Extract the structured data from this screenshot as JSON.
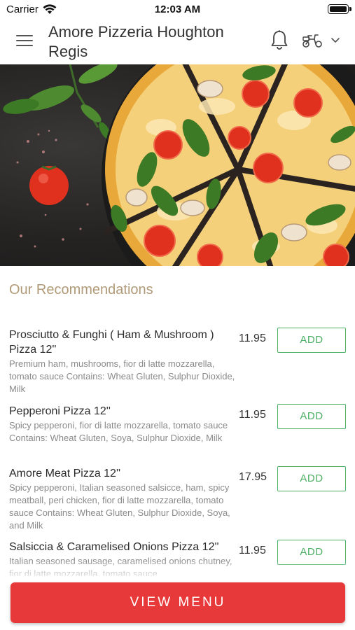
{
  "status_bar": {
    "carrier": "Carrier",
    "time": "12:03 AM"
  },
  "header": {
    "title": "Amore Pizzeria Houghton Regis"
  },
  "icons": {
    "menu": "hamburger-menu-icon",
    "notifications": "bell-icon",
    "delivery": "scooter-icon",
    "dropdown": "chevron-down-icon"
  },
  "hero": {
    "image": "pizza with tomatoes, basil and mushrooms"
  },
  "recommendations": {
    "title": "Our Recommendations",
    "items": [
      {
        "name": "Prosciutto & Funghi ( Ham & Mushroom ) Pizza 12''",
        "description": "Premium ham, mushrooms, fior di latte mozzarella, tomato sauce Contains: Wheat Gluten, Sulphur Dioxide, Milk",
        "price": "11.95",
        "button": "ADD"
      },
      {
        "name": "Pepperoni Pizza 12''",
        "description": "Spicy pepperoni, fior di latte mozzarella, tomato sauce Contains: Wheat Gluten, Soya, Sulphur Dioxide, Milk",
        "price": "11.95",
        "button": "ADD"
      },
      {
        "name": "Amore Meat Pizza 12''",
        "description": "Spicy pepperoni, Italian seasoned salsicce, ham, spicy meatball, peri chicken, fior di latte mozzarella, tomato sauce Contains: Wheat Gluten, Sulphur Dioxide, Soya, and Milk",
        "price": "17.95",
        "button": "ADD"
      },
      {
        "name": "Salsiccia & Caramelised Onions Pizza 12''",
        "description": "Italian seasoned sausage, caramelised onions chutney, fior di latte mozzarella, tomato sauce",
        "price": "11.95",
        "button": "ADD"
      }
    ]
  },
  "footer": {
    "view_menu": "VIEW MENU"
  },
  "colors": {
    "accent": "#e8393a",
    "add": "#4caf63",
    "section_title": "#b09a78"
  }
}
